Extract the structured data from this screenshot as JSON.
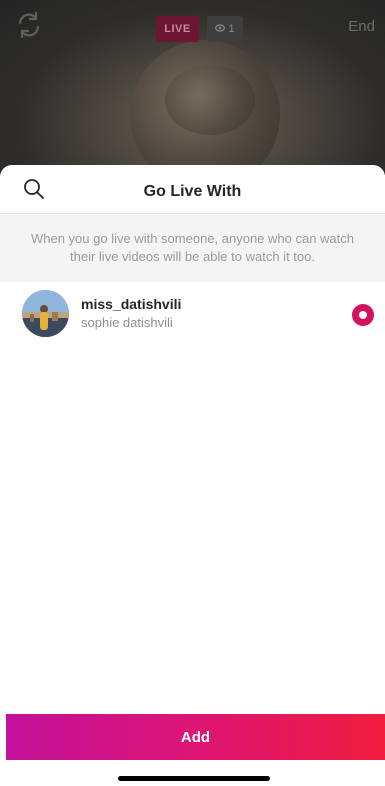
{
  "live_view": {
    "live_label": "LIVE",
    "viewer_count": "1",
    "end_label": "End"
  },
  "sheet": {
    "title": "Go Live With",
    "info_text": "When you go live with someone, anyone who can watch their live videos will be able to watch it too."
  },
  "users": [
    {
      "username": "miss_datishvili",
      "full_name": "sophie datishvili",
      "selected": true
    }
  ],
  "add_button_label": "Add",
  "colors": {
    "accent": "#d3125e",
    "gradient_start": "#c1119a",
    "gradient_end": "#ef1d3d",
    "live_badge": "#6d1633"
  },
  "icons": {
    "search": "search-icon",
    "flip_camera": "flip-camera-icon",
    "viewer": "eye-icon"
  }
}
